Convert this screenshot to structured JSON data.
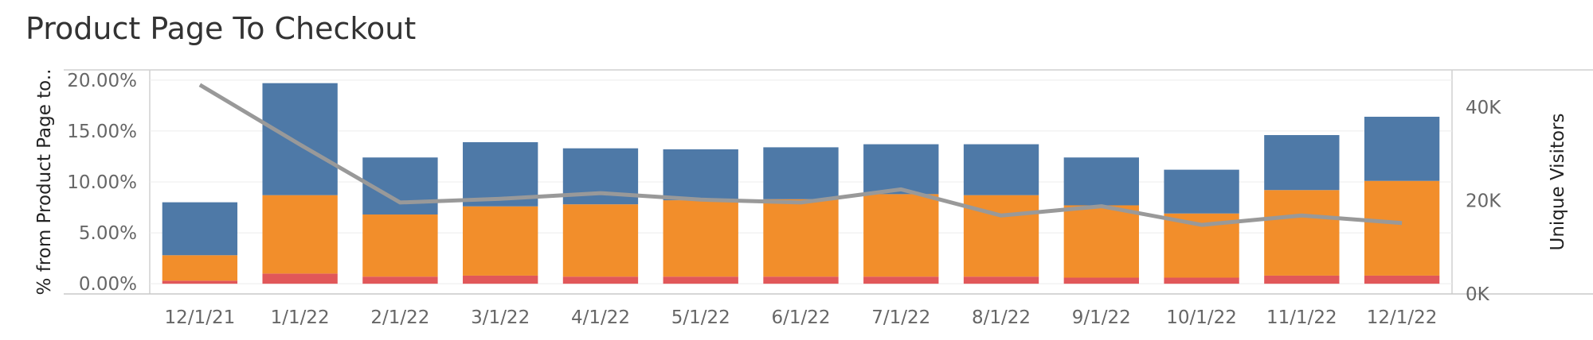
{
  "chart_data": {
    "type": "bar",
    "title": "Product Page To Checkout",
    "categories": [
      "12/1/21",
      "1/1/22",
      "2/1/22",
      "3/1/22",
      "4/1/22",
      "5/1/22",
      "6/1/22",
      "7/1/22",
      "8/1/22",
      "9/1/22",
      "10/1/22",
      "11/1/22",
      "12/1/22"
    ],
    "ylabel": "% from Product Page to..",
    "y2label": "Unique Visitors",
    "yticks": [
      "0.00%",
      "5.00%",
      "10.00%",
      "15.00%",
      "20.00%"
    ],
    "y2ticks": [
      "0K",
      "20K",
      "40K"
    ],
    "stacked_series": [
      {
        "color": "#e15759",
        "values": [
          0.3,
          1.0,
          0.7,
          0.8,
          0.7,
          0.7,
          0.7,
          0.7,
          0.7,
          0.6,
          0.6,
          0.8,
          0.8
        ]
      },
      {
        "color": "#f28e2b",
        "values": [
          2.5,
          7.7,
          6.1,
          6.8,
          7.1,
          7.5,
          7.6,
          8.1,
          8.0,
          7.1,
          6.3,
          8.4,
          9.3
        ]
      },
      {
        "color": "#4e79a7",
        "values": [
          5.2,
          11.0,
          5.6,
          6.3,
          5.5,
          5.0,
          5.1,
          4.9,
          5.0,
          4.7,
          4.3,
          5.4,
          6.3
        ]
      }
    ],
    "line_series": {
      "color": "#999999",
      "axis": "right",
      "values": [
        44800,
        32000,
        19600,
        20400,
        21600,
        20200,
        19600,
        22400,
        16800,
        18800,
        14800,
        16800,
        15200
      ]
    },
    "ylim": [
      -1,
      21
    ],
    "y2lim": [
      0,
      48000
    ],
    "grid": true
  }
}
